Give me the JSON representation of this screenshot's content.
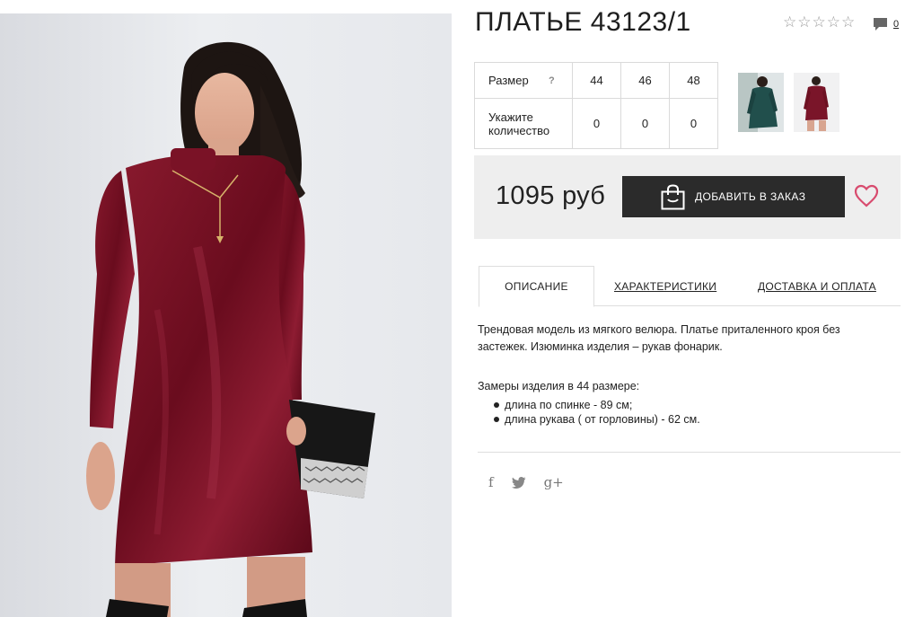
{
  "product": {
    "title": "ПЛАТЬЕ 43123/1",
    "comments_count": "0",
    "rating": 0
  },
  "sizes": {
    "row_label": "Размер",
    "help": "?",
    "values": [
      "44",
      "46",
      "48"
    ],
    "qty_label": "Укажите количество",
    "qty": [
      "0",
      "0",
      "0"
    ]
  },
  "purchase": {
    "price": "1095 руб",
    "add_button": "ДОБАВИТЬ В ЗАКАЗ"
  },
  "tabs": [
    {
      "label": "ОПИСАНИЕ"
    },
    {
      "label": "ХАРАКТЕРИСТИКИ"
    },
    {
      "label": "ДОСТАВКА И ОПЛАТА"
    }
  ],
  "description": {
    "text": "Трендовая модель из мягкого велюра. Платье приталенного кроя без застежек. Изюминка изделия – рукав фонарик.",
    "measures_title": "Замеры изделия в 44 размере:",
    "measures": [
      "длина по спинке - 89 см;",
      "длина рукава ( от горловины) - 62 см."
    ]
  },
  "social": {
    "facebook": "f",
    "twitter": "t",
    "google": "g+"
  },
  "colors": {
    "dress": "#6e0d20",
    "button": "#2b2b2b",
    "buybox": "#eeeeee",
    "heart": "#d84b6e",
    "thumb_green": "#214f4c"
  },
  "icons": [
    "star-icon",
    "comment-icon",
    "shopping-bag-icon",
    "heart-icon",
    "facebook-icon",
    "twitter-icon",
    "google-plus-icon"
  ]
}
